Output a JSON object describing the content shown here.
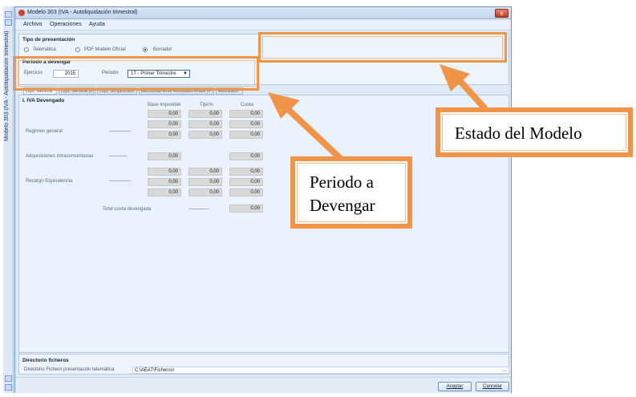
{
  "side_strip": {
    "label": "Modelo 303 (IVA - Autoliquidación trimestral)"
  },
  "window": {
    "title": "Modelo 303 (IVA - Autoliquidación trimestral)",
    "close": "x"
  },
  "menu": {
    "items": [
      "Archivo",
      "Operaciones",
      "Ayuda"
    ]
  },
  "tipo_presentacion": {
    "title": "Tipo de presentación",
    "options": [
      "Telemática",
      "PDF Modelo Oficial",
      "Borrador"
    ],
    "selected": "Borrador"
  },
  "periodo": {
    "title": "Periodo a devengar",
    "ejercicio_label": "Ejercicio",
    "ejercicio_value": "2015",
    "periodo_label": "Periodo",
    "periodo_value": "1T - Primer Trimestre"
  },
  "tabs": [
    "Liqu. General",
    "Liqu. General (2)",
    "Liqu. Simplificado",
    "Exclusivamente Resultado Anual (4T)",
    "Resultado"
  ],
  "iva_devengado": {
    "title": "I. IVA Devengado",
    "headers": [
      "Base Imponible",
      "Tipo%",
      "Cuota"
    ],
    "regimen_general": {
      "label": "Regimen general",
      "dashes": "------------------",
      "rows": [
        [
          "0,00",
          "0,00",
          "0,00"
        ],
        [
          "0,00",
          "0,00",
          "0,00"
        ],
        [
          "0,00",
          "0,00",
          "0,00"
        ]
      ]
    },
    "adquisiciones": {
      "label": "Adquisiciones intracomunitarias",
      "dashes": "---------------",
      "base": "0,00",
      "cuota": "0,00"
    },
    "recargo": {
      "label": "Recargo Equivalencia",
      "dashes": "------------------",
      "rows": [
        [
          "0,00",
          "0,00",
          "0,00"
        ],
        [
          "0,00",
          "0,00",
          "0,00"
        ],
        [
          "0,00",
          "0,00",
          "0,00"
        ]
      ]
    },
    "total": {
      "label": "Total cuota devengada",
      "dashes": "-----------------",
      "value": "0,00"
    }
  },
  "directorio": {
    "title": "Directorio ficheros",
    "label": "Directorio Fichero presentación telemática",
    "path": "C:\\AEAT\\Ficheros\\",
    "browse": "..."
  },
  "buttons": {
    "accept": "Aceptar",
    "cancel": "Cancelar"
  },
  "callouts": {
    "estado": "Estado del Modelo",
    "periodo_line1": "Periodo a",
    "periodo_line2": "Devengar"
  },
  "colors": {
    "highlight": "#f0944a",
    "window_bg": "#dfeaf7",
    "cell_bg": "#d9d9d9"
  }
}
